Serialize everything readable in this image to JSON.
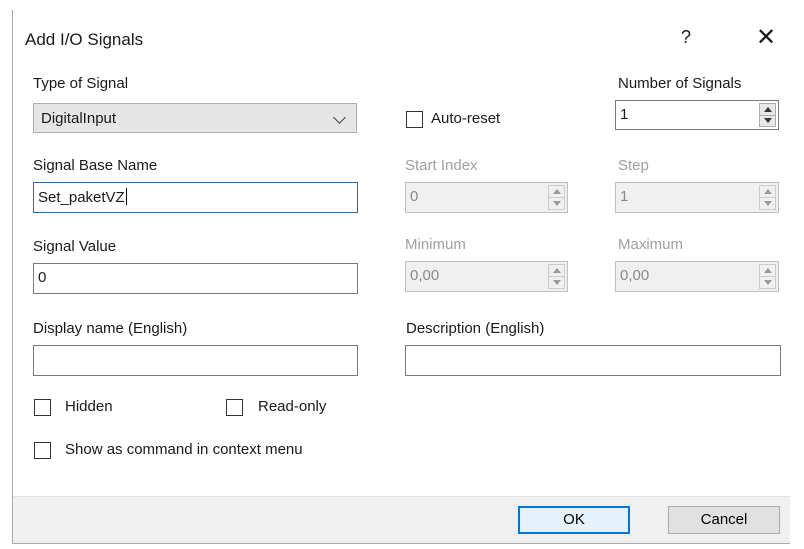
{
  "dialog": {
    "title": "Add I/O Signals",
    "help": "?",
    "close": "✕"
  },
  "type_of_signal": {
    "label": "Type of Signal",
    "value": "DigitalInput"
  },
  "auto_reset": {
    "label": "Auto-reset",
    "checked": false
  },
  "number_of_signals": {
    "label": "Number of Signals",
    "value": "1"
  },
  "signal_base_name": {
    "label": "Signal Base Name",
    "value": "Set_paketVZ"
  },
  "start_index": {
    "label": "Start Index",
    "value": "0"
  },
  "step": {
    "label": "Step",
    "value": "1"
  },
  "signal_value": {
    "label": "Signal Value",
    "value": "0"
  },
  "minimum": {
    "label": "Minimum",
    "value": "0,00"
  },
  "maximum": {
    "label": "Maximum",
    "value": "0,00"
  },
  "display_name": {
    "label": "Display name (English)",
    "value": ""
  },
  "description": {
    "label": "Description (English)",
    "value": ""
  },
  "hidden": {
    "label": "Hidden",
    "checked": false
  },
  "read_only": {
    "label": "Read-only",
    "checked": false
  },
  "show_as_command": {
    "label": "Show as command in context menu",
    "checked": false
  },
  "buttons": {
    "ok": "OK",
    "cancel": "Cancel"
  },
  "colors": {
    "accent": "#0078d7",
    "focus_border": "#1a6fc9",
    "footer_bg": "#f0f0f0",
    "disabled_text": "#a0a0a0"
  }
}
